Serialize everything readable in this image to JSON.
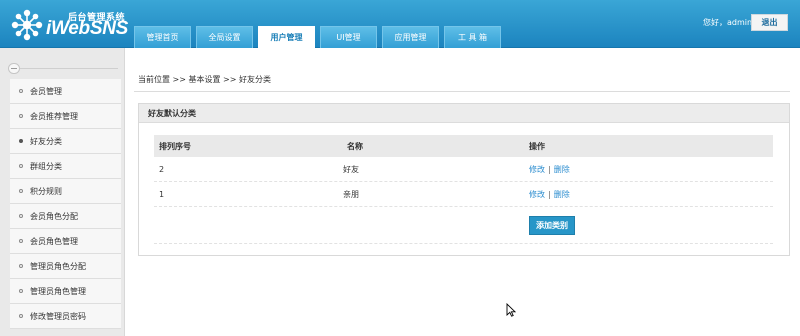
{
  "header": {
    "logo_subtitle": "后台管理系统",
    "logo_title": "iWebSNS",
    "greeting": "您好，admin",
    "logout_label": "退出",
    "tabs": [
      {
        "label": "管理首页"
      },
      {
        "label": "全局设置"
      },
      {
        "label": "用户管理"
      },
      {
        "label": "UI管理"
      },
      {
        "label": "应用管理"
      },
      {
        "label": "工 具 箱"
      }
    ]
  },
  "sidebar": {
    "items": [
      {
        "label": "会员管理"
      },
      {
        "label": "会员推荐管理"
      },
      {
        "label": "好友分类"
      },
      {
        "label": "群组分类"
      },
      {
        "label": "积分规则"
      },
      {
        "label": "会员角色分配"
      },
      {
        "label": "会员角色管理"
      },
      {
        "label": "管理员角色分配"
      },
      {
        "label": "管理员角色管理"
      },
      {
        "label": "修改管理员密码"
      }
    ]
  },
  "breadcrumb": "当前位置 >> 基本设置 >> 好友分类",
  "panel": {
    "title": "好友默认分类",
    "columns": [
      "排列序号",
      "名称",
      "操作"
    ],
    "rows": [
      {
        "order": "2",
        "name": "好友",
        "edit": "修改",
        "delete": "删除"
      },
      {
        "order": "1",
        "name": "亲朋",
        "edit": "修改",
        "delete": "删除"
      }
    ],
    "add_button": "添加类别"
  },
  "colors": {
    "header_blue": "#2a96cc",
    "accent_link": "#2a8ccf",
    "button_blue": "#2796c8"
  }
}
